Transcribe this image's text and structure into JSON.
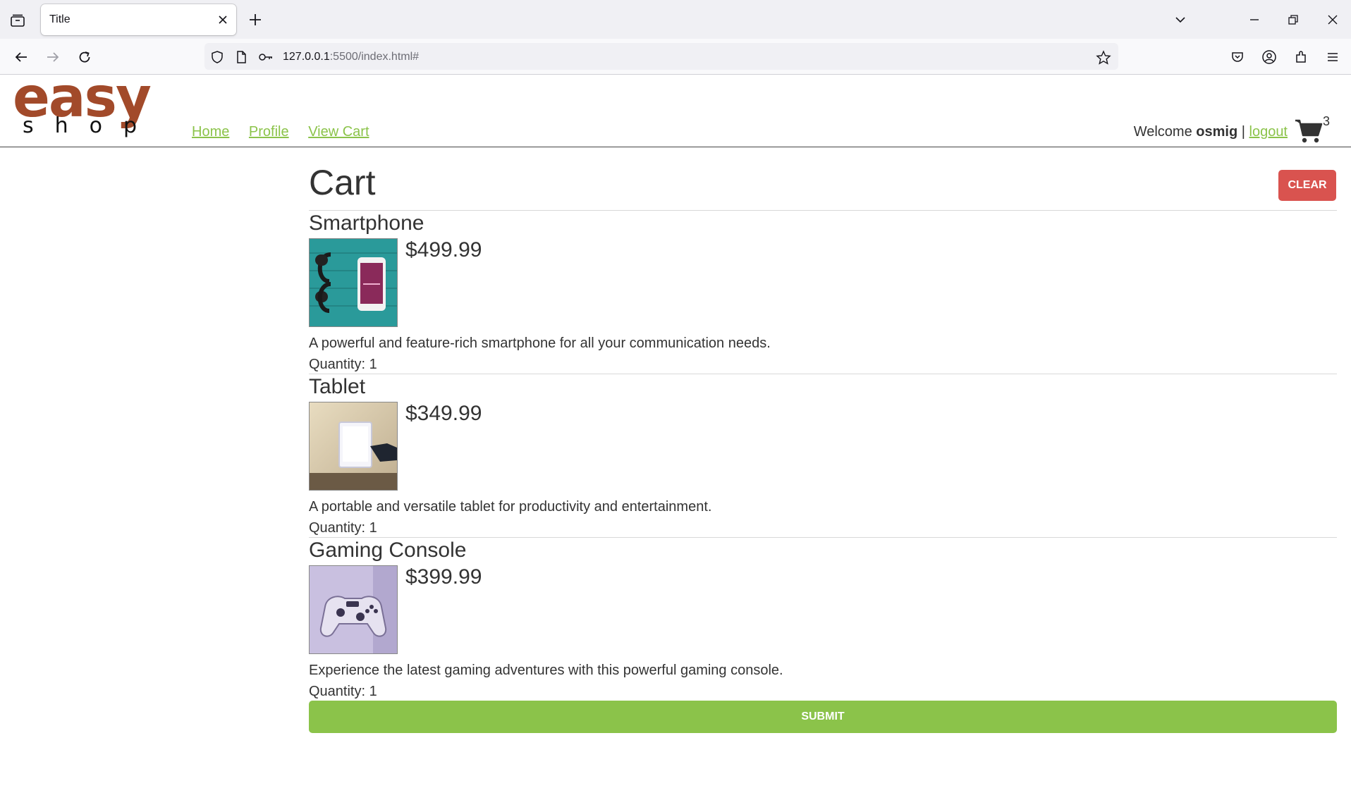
{
  "browser": {
    "tab_title": "Title",
    "url_host": "127.0.0.1",
    "url_path": ":5500/index.html#"
  },
  "header": {
    "logo_top": "easy",
    "logo_bottom": "shop",
    "nav": {
      "home": "Home",
      "profile": "Profile",
      "view_cart": "View Cart"
    },
    "welcome_text": "Welcome",
    "username": "osmig",
    "separator": "|",
    "logout": "logout",
    "cart_count": "3"
  },
  "cart": {
    "title": "Cart",
    "clear_label": "CLEAR",
    "submit_label": "SUBMIT",
    "items": [
      {
        "name": "Smartphone",
        "price": "$499.99",
        "description": "A powerful and feature-rich smartphone for all your communication needs.",
        "quantity": "Quantity: 1"
      },
      {
        "name": "Tablet",
        "price": "$349.99",
        "description": "A portable and versatile tablet for productivity and entertainment.",
        "quantity": "Quantity: 1"
      },
      {
        "name": "Gaming Console",
        "price": "$399.99",
        "description": "Experience the latest gaming adventures with this powerful gaming console.",
        "quantity": "Quantity: 1"
      }
    ]
  },
  "colors": {
    "brand": "#a24a2a",
    "link": "#8bc34a",
    "clear_button": "#d9534f",
    "submit_button": "#8bc34a"
  },
  "icons": [
    "tab-list-icon",
    "close-icon",
    "plus-icon",
    "chevron-down-icon",
    "minimize-icon",
    "restore-icon",
    "back-icon",
    "forward-icon",
    "reload-icon",
    "shield-icon",
    "page-icon",
    "key-icon",
    "star-icon",
    "pocket-icon",
    "account-icon",
    "extensions-icon",
    "menu-icon",
    "cart-icon"
  ]
}
